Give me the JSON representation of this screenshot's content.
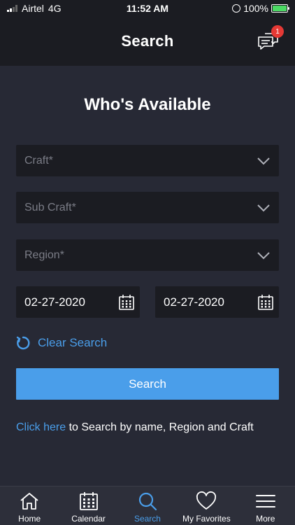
{
  "status_bar": {
    "carrier": "Airtel",
    "network": "4G",
    "time": "11:52 AM",
    "battery": "100%"
  },
  "header": {
    "title": "Search",
    "notification_count": "1"
  },
  "main": {
    "heading": "Who's Available",
    "craft_placeholder": "Craft*",
    "subcraft_placeholder": "Sub Craft*",
    "region_placeholder": "Region*",
    "start_date": "02-27-2020",
    "end_date": "02-27-2020",
    "clear_label": "Clear Search",
    "search_label": "Search",
    "hint_link": "Click here",
    "hint_rest": " to Search by name, Region and Craft"
  },
  "tabs": [
    {
      "label": "Home"
    },
    {
      "label": "Calendar"
    },
    {
      "label": "Search"
    },
    {
      "label": "My Favorites"
    },
    {
      "label": "More"
    }
  ],
  "colors": {
    "accent": "#4a9eea",
    "background": "#272935",
    "field": "#1b1c22",
    "badge": "#e53935"
  }
}
